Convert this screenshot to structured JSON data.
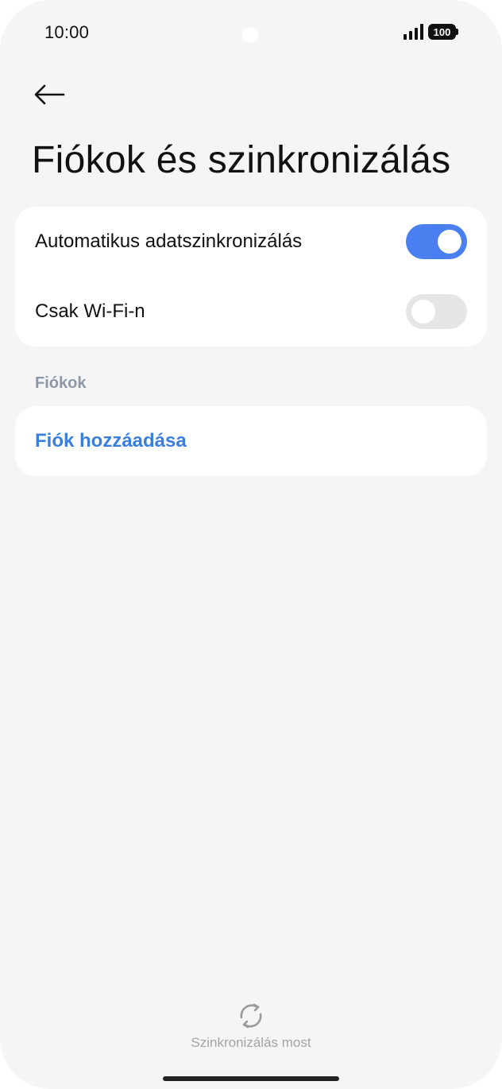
{
  "status_bar": {
    "time": "10:00",
    "battery_level": "100",
    "signal_icon": "signal-bars-icon"
  },
  "header": {
    "back_icon": "arrow-left-icon",
    "title": "Fiókok és szinkronizálás"
  },
  "settings": {
    "auto_sync": {
      "label": "Automatikus adatszinkronizálás",
      "enabled": true
    },
    "wifi_only": {
      "label": "Csak Wi-Fi-n",
      "enabled": false
    }
  },
  "accounts": {
    "section_title": "Fiókok",
    "add_account_label": "Fiók hozzáadása"
  },
  "sync_now": {
    "icon": "sync-icon",
    "label": "Szinkronizálás most"
  },
  "colors": {
    "accent": "#4a7ff0",
    "link": "#3a7ee0",
    "background": "#f5f5f5",
    "card": "#ffffff",
    "section_header": "#8e97a8"
  }
}
